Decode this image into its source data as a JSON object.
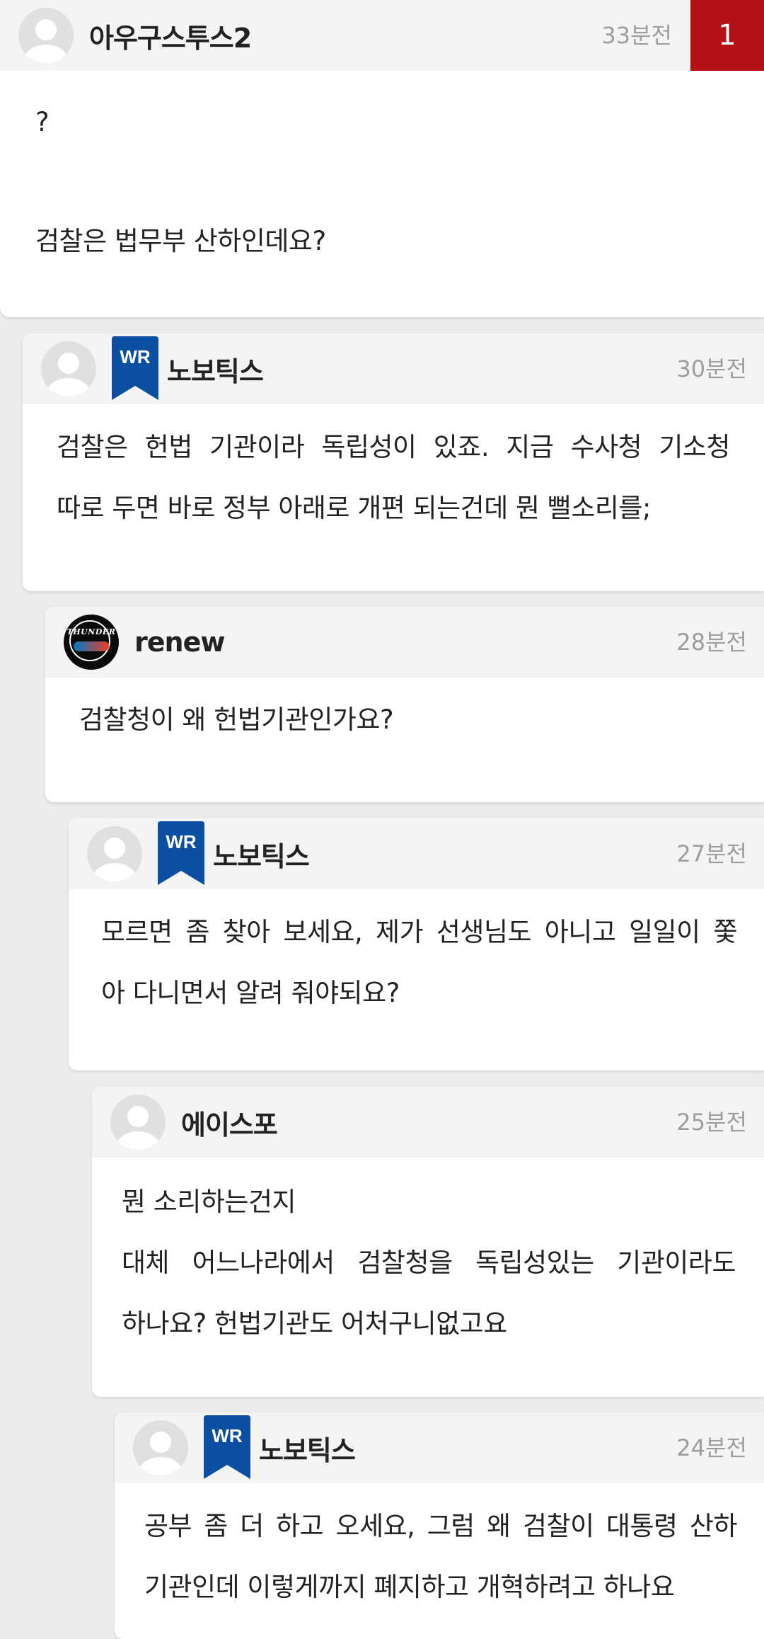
{
  "comments": [
    {
      "user": "아우구스투스2",
      "time": "33분전",
      "count": "1",
      "lines": [
        "?",
        "검찰은 법무부 산하인데요?"
      ]
    },
    {
      "user": "노보틱스",
      "badge": "WR",
      "time": "30분전",
      "lines": [
        "검찰은 헌법 기관이라 독립성이 있죠. 지금 수사청 기소청",
        "따로 두면 바로 정부 아래로 개편 되는건데 뭔 뻘소리를;"
      ]
    },
    {
      "user": "renew",
      "avatar": "thunder",
      "avatar_text": "THUNDER",
      "time": "28분전",
      "lines": [
        "검찰청이 왜 헌법기관인가요?"
      ]
    },
    {
      "user": "노보틱스",
      "badge": "WR",
      "time": "27분전",
      "lines": [
        "모르면 좀 찾아 보세요, 제가 선생님도 아니고 일일이 쫓",
        "아 다니면서 알려 줘야되요?"
      ]
    },
    {
      "user": "에이스포",
      "time": "25분전",
      "lines": [
        "뭔 소리하는건지",
        "대체 어느나라에서 검찰청을 독립성있는 기관이라도",
        "하나요? 헌법기관도 어처구니없고요"
      ]
    },
    {
      "user": "노보틱스",
      "badge": "WR",
      "time": "24분전",
      "lines": [
        "공부 좀 더 하고 오세요, 그럼 왜 검찰이 대통령 산하",
        "기관인데 이렇게까지 폐지하고 개혁하려고 하나요"
      ]
    }
  ],
  "colors": {
    "background": "#ececec",
    "header": "#f4f4f4",
    "badge": "#0b4fa3",
    "count_box": "#b31217",
    "time": "#9e9e9e"
  },
  "icons": {
    "avatar": "default-avatar-icon",
    "writer": "wr-bookmark-badge",
    "team_logo": "thunder-logo"
  }
}
